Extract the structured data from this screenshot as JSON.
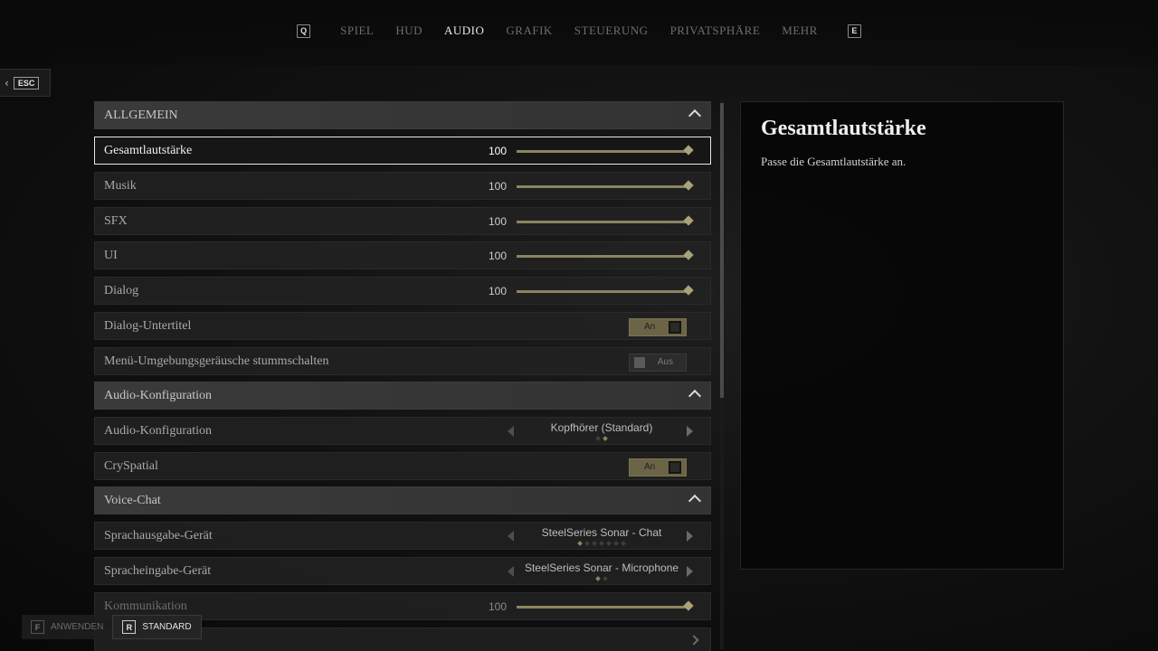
{
  "nav": {
    "prev_key": "Q",
    "next_key": "E",
    "tabs": [
      "SPIEL",
      "HUD",
      "AUDIO",
      "GRAFIK",
      "STEUERUNG",
      "PRIVATSPHÄRE",
      "MEHR"
    ],
    "active_tab": "AUDIO"
  },
  "back": {
    "key": "ESC"
  },
  "settings": {
    "general_header": "ALLGEMEIN",
    "master": {
      "label": "Gesamtlautstärke",
      "value": "100",
      "level": 1.0
    },
    "music": {
      "label": "Musik",
      "value": "100",
      "level": 1.0
    },
    "sfx": {
      "label": "SFX",
      "value": "100",
      "level": 1.0
    },
    "ui": {
      "label": "UI",
      "value": "100",
      "level": 1.0
    },
    "dialog": {
      "label": "Dialog",
      "value": "100",
      "level": 1.0
    },
    "subtitles": {
      "label": "Dialog-Untertitel",
      "state": "An"
    },
    "mute_menu": {
      "label": "Menü-Umgebungsgeräusche stummschalten",
      "state": "Aus"
    },
    "audio_config_header": "Audio-Konfiguration",
    "audio_config": {
      "label": "Audio-Konfiguration",
      "value": "Kopfhörer (Standard)"
    },
    "cryspatial": {
      "label": "CrySpatial",
      "state": "An"
    },
    "voice_header": "Voice-Chat",
    "output_device": {
      "label": "Sprachausgabe-Gerät",
      "value": "SteelSeries Sonar - Chat"
    },
    "input_device": {
      "label": "Spracheingabe-Gerät",
      "value": "SteelSeries Sonar - Microphone"
    },
    "communication": {
      "label": "Kommunikation",
      "value": "100",
      "level": 1.0
    }
  },
  "detail": {
    "title": "Gesamtlautstärke",
    "description": "Passe die Gesamtlautstärke an."
  },
  "footer": {
    "apply_key": "F",
    "apply_label": "ANWENDEN",
    "default_key": "R",
    "default_label": "STANDARD"
  },
  "colors": {
    "accent": "#8b8560",
    "selection_border": "#e8e8e4"
  }
}
